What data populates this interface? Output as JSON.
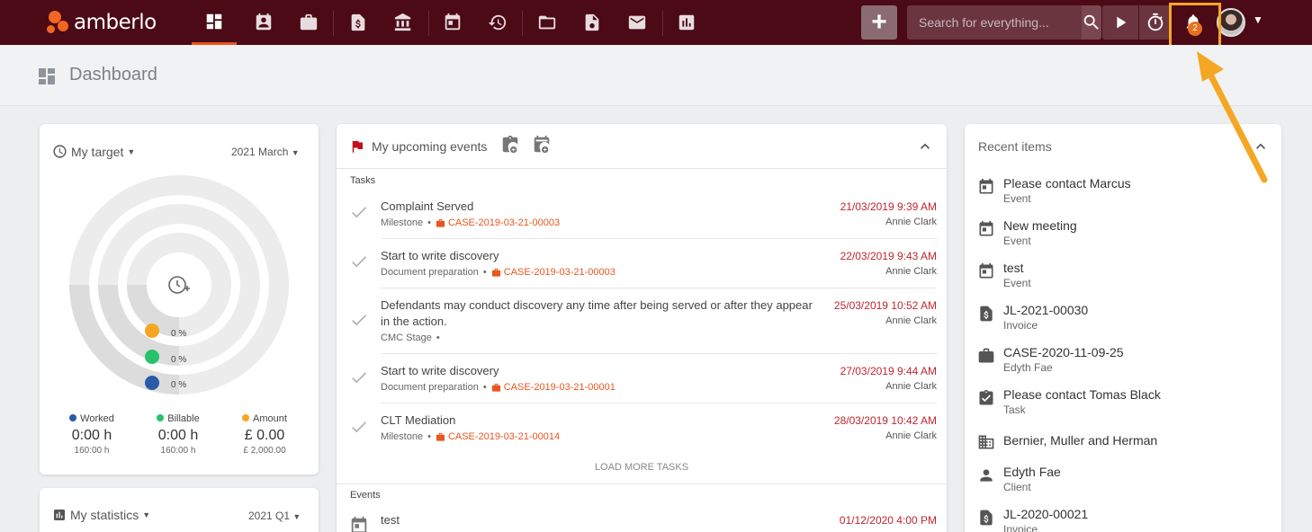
{
  "app": {
    "name": "amberlo"
  },
  "search": {
    "placeholder": "Search for everything..."
  },
  "notifications": {
    "count": "2"
  },
  "page": {
    "title": "Dashboard"
  },
  "target": {
    "title": "My target",
    "period": "2021 March",
    "rings": [
      {
        "label": "0 %",
        "color": "#f5a623"
      },
      {
        "label": "0 %",
        "color": "#27c26c"
      },
      {
        "label": "0 %",
        "color": "#2a5ba8"
      }
    ],
    "legend": [
      {
        "name": "Worked",
        "color": "#2a5ba8",
        "value": "0:00 h",
        "target": "160:00 h"
      },
      {
        "name": "Billable",
        "color": "#27c26c",
        "value": "0:00 h",
        "target": "160:00 h"
      },
      {
        "name": "Amount",
        "color": "#f5a623",
        "value": "£ 0.00",
        "target": "£ 2,000.00"
      }
    ]
  },
  "statistics": {
    "title": "My statistics",
    "period": "2021 Q1"
  },
  "events": {
    "title": "My upcoming events",
    "tasks_label": "Tasks",
    "events_label": "Events",
    "load_more": "LOAD MORE TASKS",
    "tasks": [
      {
        "title": "Complaint Served",
        "type": "Milestone",
        "case": "CASE-2019-03-21-00003",
        "date": "21/03/2019 9:39 AM",
        "user": "Annie Clark"
      },
      {
        "title": "Start to write discovery",
        "type": "Document preparation",
        "case": "CASE-2019-03-21-00003",
        "date": "22/03/2019 9:43 AM",
        "user": "Annie Clark"
      },
      {
        "title": "Defendants may conduct discovery any time after being served or after they appear",
        "title2": "in the action.",
        "type": "CMC Stage",
        "case": "",
        "date": "25/03/2019 10:52 AM",
        "user": "Annie Clark"
      },
      {
        "title": "Start to write discovery",
        "type": "Document preparation",
        "case": "CASE-2019-03-21-00001",
        "date": "27/03/2019 9:44 AM",
        "user": "Annie Clark"
      },
      {
        "title": "CLT Mediation",
        "type": "Milestone",
        "case": "CASE-2019-03-21-00014",
        "date": "28/03/2019 10:42 AM",
        "user": "Annie Clark"
      }
    ],
    "event_items": [
      {
        "title": "test",
        "date": "01/12/2020 4:00 PM"
      }
    ]
  },
  "recent": {
    "title": "Recent items",
    "items": [
      {
        "icon": "calendar-icon",
        "title": "Please contact Marcus",
        "sub": "Event"
      },
      {
        "icon": "calendar-icon",
        "title": "New meeting",
        "sub": "Event"
      },
      {
        "icon": "calendar-icon",
        "title": "test",
        "sub": "Event"
      },
      {
        "icon": "invoice-icon",
        "title": "JL-2021-00030",
        "sub": "Invoice"
      },
      {
        "icon": "briefcase-icon",
        "title": "CASE-2020-11-09-25",
        "sub": "Edyth Fae"
      },
      {
        "icon": "task-icon",
        "title": "Please contact Tomas Black",
        "sub": "Task"
      },
      {
        "icon": "building-icon",
        "title": "Bernier, Muller and Herman",
        "sub": ""
      },
      {
        "icon": "person-icon",
        "title": "Edyth Fae",
        "sub": "Client"
      },
      {
        "icon": "invoice-icon",
        "title": "JL-2020-00021",
        "sub": "Invoice"
      }
    ]
  }
}
